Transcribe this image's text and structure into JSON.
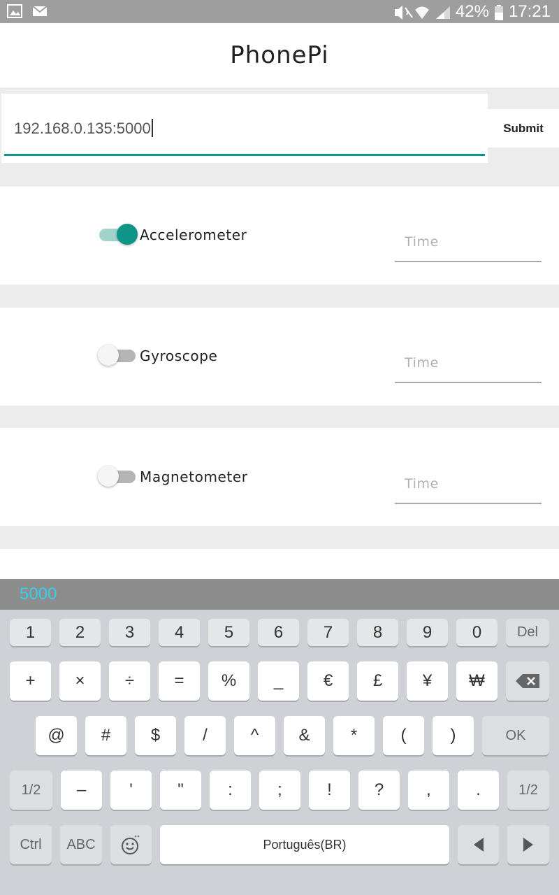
{
  "status_bar": {
    "battery_text": "42%",
    "time": "17:21",
    "left_icons": [
      "gallery-icon",
      "mail-icon"
    ],
    "right_icons": [
      "vibrate-icon",
      "wifi-icon",
      "signal-icon",
      "battery-icon"
    ]
  },
  "app": {
    "title": "PhonePi"
  },
  "server": {
    "address": "192.168.0.135:5000",
    "submit_label": "Submit"
  },
  "sensors": [
    {
      "label": "Accelerometer",
      "enabled": true,
      "time_placeholder": "Time"
    },
    {
      "label": "Gyroscope",
      "enabled": false,
      "time_placeholder": "Time"
    },
    {
      "label": "Magnetometer",
      "enabled": false,
      "time_placeholder": "Time"
    }
  ],
  "keyboard": {
    "suggestion": "5000",
    "row1": [
      "1",
      "2",
      "3",
      "4",
      "5",
      "6",
      "7",
      "8",
      "9",
      "0"
    ],
    "row1_extra": "Del",
    "row2": [
      "+",
      "×",
      "÷",
      "=",
      "%",
      "_",
      "€",
      "£",
      "¥",
      "₩"
    ],
    "row3": [
      "@",
      "#",
      "$",
      "/",
      "^",
      "&",
      "*",
      "(",
      ")"
    ],
    "row3_extra": "OK",
    "row4_left": "1/2",
    "row4": [
      "–",
      "'",
      "\"",
      ":",
      ";",
      "!",
      "?",
      ",",
      "."
    ],
    "row4_right": "1/2",
    "ctrl": "Ctrl",
    "abc": "ABC",
    "space": "Português(BR)"
  },
  "colors": {
    "accent": "#0f9488",
    "suggestion": "#34d0ea"
  }
}
